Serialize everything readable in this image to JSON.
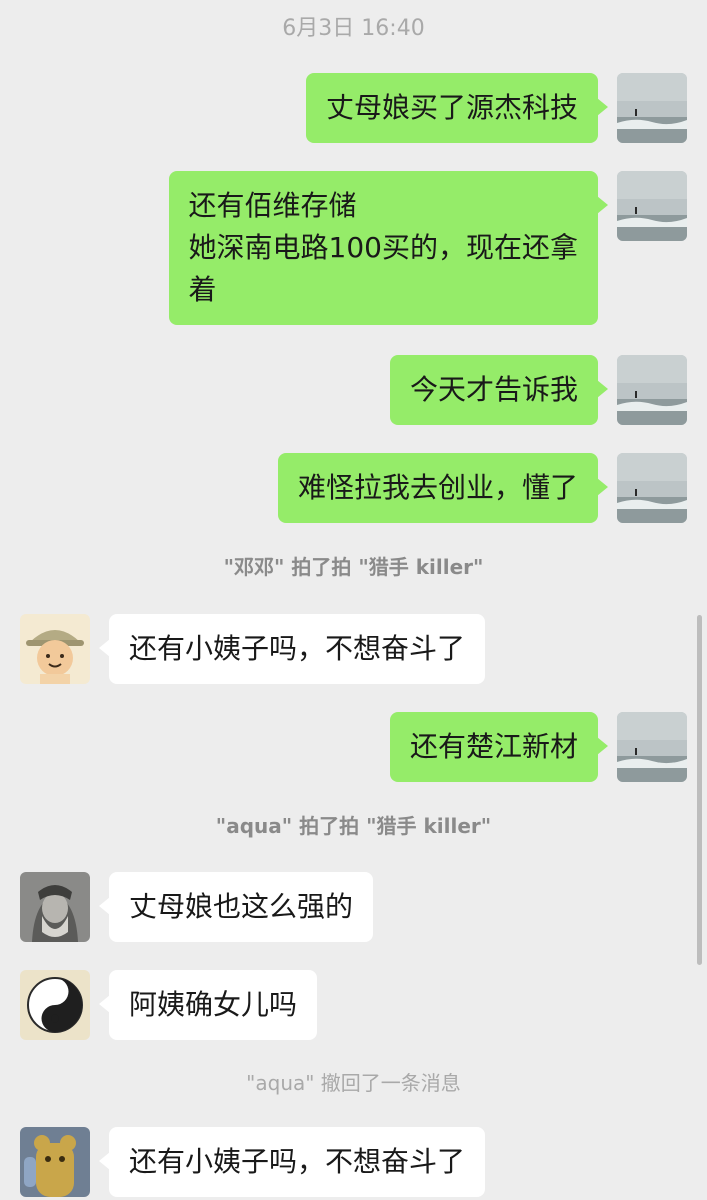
{
  "timestamp": "6月3日 16:40",
  "messages": [
    {
      "from": "self",
      "lines": [
        "丈母娘买了源杰科技"
      ]
    },
    {
      "from": "self",
      "lines": [
        "还有佰维存储",
        "她深南电路100买的，现在还拿",
        "着"
      ]
    },
    {
      "from": "self",
      "lines": [
        "今天才告诉我"
      ]
    },
    {
      "from": "self",
      "lines": [
        "难怪拉我去创业，懂了"
      ]
    },
    {
      "from": "other",
      "lines": [
        "还有小姨子吗，不想奋斗了"
      ]
    },
    {
      "from": "self",
      "lines": [
        "还有楚江新材"
      ]
    },
    {
      "from": "other",
      "lines": [
        "丈母娘也这么强的"
      ]
    },
    {
      "from": "other",
      "lines": [
        "阿姨确女儿吗"
      ]
    },
    {
      "from": "other",
      "lines": [
        "还有小姨子吗，不想奋斗了"
      ]
    }
  ],
  "system": [
    "\"邓邓\" 拍了拍 \"猎手 killer\"",
    "\"aqua\" 拍了拍 \"猎手 killer\"",
    "\"aqua\" 撤回了一条消息"
  ],
  "avatars": {
    "self": "ocean-surfer-photo",
    "cartoon": "cartoon-hat-character",
    "leonardo": "portrait-sketch",
    "yinyang": "yin-yang-art",
    "bear": "gold-bear-figure"
  },
  "colors": {
    "background": "#ededed",
    "self_bubble": "#95ec69",
    "other_bubble": "#ffffff",
    "system_text": "#8a8a8a"
  }
}
